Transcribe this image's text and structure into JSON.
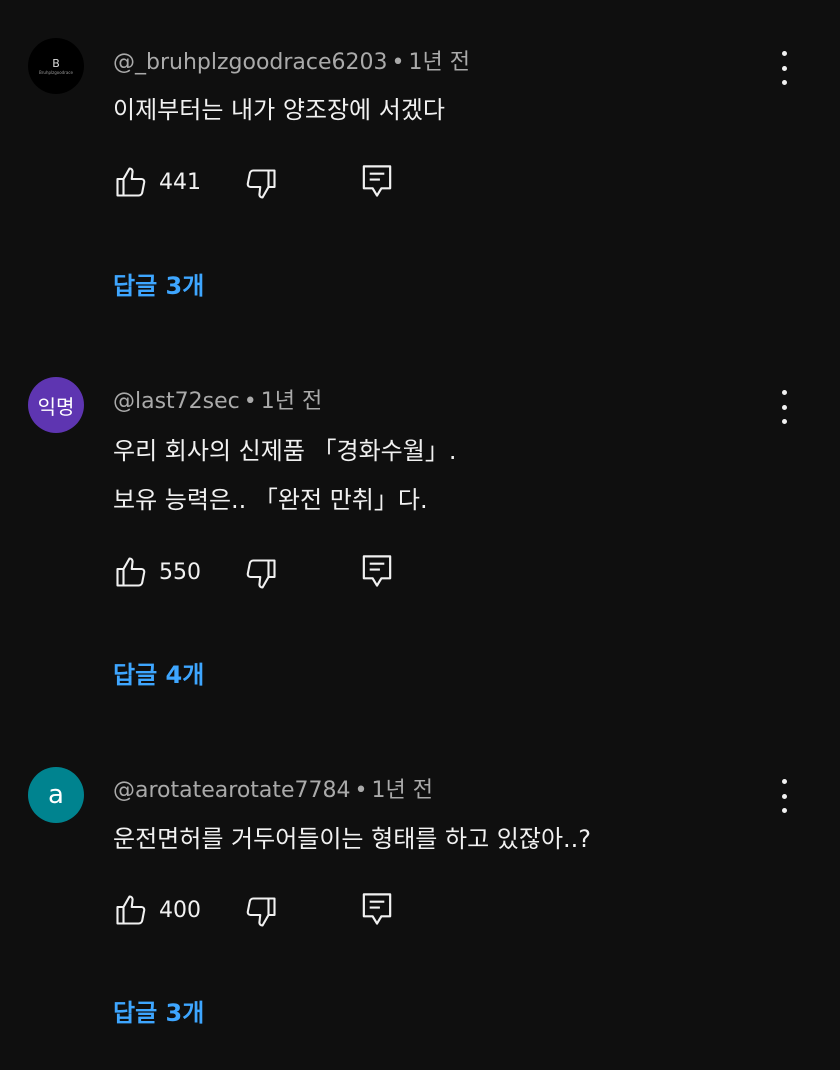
{
  "comments": [
    {
      "avatar": {
        "text": "B",
        "subtext": "Bruhplzgoodrace",
        "style": "black"
      },
      "handle": "@_bruhplzgoodrace6203",
      "time": "1년 전",
      "lines": [
        "이제부터는 내가 양조장에 서겠다"
      ],
      "likes": "441",
      "replies": "답글 3개"
    },
    {
      "avatar": {
        "text": "익명",
        "style": "purple"
      },
      "handle": "@last72sec",
      "time": "1년 전",
      "lines": [
        "우리 회사의 신제품 「경화수월」.",
        "보유 능력은.. 「완전 만취」다."
      ],
      "likes": "550",
      "replies": "답글 4개"
    },
    {
      "avatar": {
        "text": "a",
        "style": "teal"
      },
      "handle": "@arotatearotate7784",
      "time": "1년 전",
      "lines": [
        "운전면허를 거두어들이는 형태를 하고 있잖아..?"
      ],
      "likes": "400",
      "replies": "답글 3개"
    }
  ],
  "meta_separator": "•",
  "icons": {
    "like": "thumb-up-icon",
    "dislike": "thumb-down-icon",
    "reply": "reply-comment-icon",
    "more": "more-vertical-icon"
  },
  "colors": {
    "background": "#0f0f0f",
    "text": "#f1f1f1",
    "meta": "#aaaaaa",
    "link": "#3ea6ff",
    "avatar_purple": "#5e35b1",
    "avatar_teal": "#00838f"
  }
}
